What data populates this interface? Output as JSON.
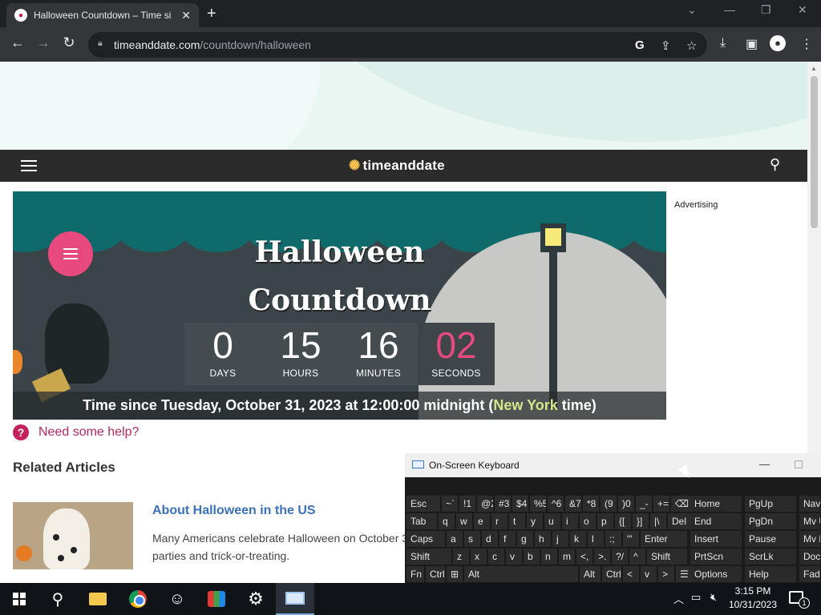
{
  "browser": {
    "tab_title": "Halloween Countdown – Time si",
    "url_host": "timeanddate.com",
    "url_path": "/countdown/halloween"
  },
  "site": {
    "logo_text": "timeanddate"
  },
  "hero": {
    "title_line1": "Halloween",
    "title_line2": "Countdown",
    "countdown": {
      "days": "0",
      "days_label": "DAYS",
      "hours": "15",
      "hours_label": "HOURS",
      "minutes": "16",
      "minutes_label": "MINUTES",
      "seconds": "02",
      "seconds_label": "SECONDS"
    },
    "footer_prefix": "Time since Tuesday, October 31, 2023 at 12:00:00 midnight (",
    "footer_city": "New York",
    "footer_suffix": " time)",
    "accent_color": "#e8497e"
  },
  "sidebar": {
    "advertising_label": "Advertising"
  },
  "help": {
    "label": "Need some help?"
  },
  "related": {
    "heading": "Related Articles",
    "articles": [
      {
        "title": "About Halloween in the US",
        "desc": "Many Americans celebrate Halloween on October 3 parties and trick-or-treating."
      }
    ]
  },
  "osk": {
    "title": "On-Screen Keyboard",
    "rows": [
      [
        "Esc",
        "~`",
        "!1",
        "@2",
        "#3",
        "$4",
        "%5",
        "^6",
        "&7",
        "*8",
        "(9",
        ")0",
        "_-",
        "+=",
        "⌫"
      ],
      [
        "Tab",
        "q",
        "w",
        "e",
        "r",
        "t",
        "y",
        "u",
        "i",
        "o",
        "p",
        "{[",
        "}]",
        "|\\",
        "Del"
      ],
      [
        "Caps",
        "a",
        "s",
        "d",
        "f",
        "g",
        "h",
        "j",
        "k",
        "l",
        ":;",
        "\"'",
        "Enter"
      ],
      [
        "Shift",
        "z",
        "x",
        "c",
        "v",
        "b",
        "n",
        "m",
        "<,",
        ">.",
        "?/",
        "^",
        "Shift"
      ],
      [
        "Fn",
        "Ctrl",
        "⊞",
        "Alt",
        "Alt",
        "Ctrl",
        "<",
        "v",
        ">",
        "☰"
      ]
    ],
    "nav_keys": [
      [
        "Home",
        "PgUp",
        "Nav"
      ],
      [
        "End",
        "PgDn",
        "Mv Up"
      ],
      [
        "Insert",
        "Pause",
        "Mv Dn"
      ],
      [
        "PrtScn",
        "ScrLk",
        "Dock"
      ],
      [
        "Options",
        "Help",
        "Fade"
      ]
    ]
  },
  "taskbar": {
    "time": "3:15 PM",
    "date": "10/31/2023",
    "notification_count": "1"
  }
}
